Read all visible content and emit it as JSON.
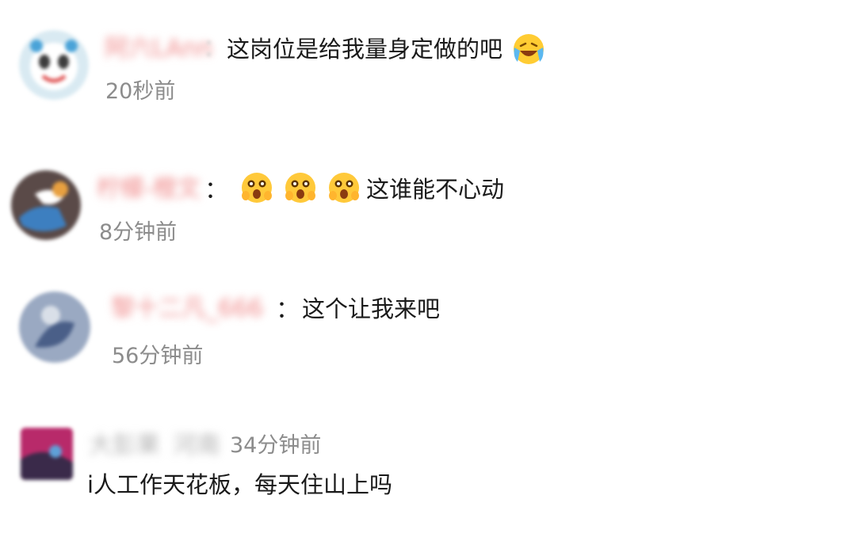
{
  "comments": [
    {
      "username": "阿六LAnn",
      "separator": "：",
      "text": "这岗位是给我量身定做的吧",
      "emoji_icons": [
        "crying-laughing-emoji-icon"
      ],
      "time": "20秒前"
    },
    {
      "username": "柠檬-橙文",
      "separator": "：",
      "emoji_icons": [
        "excited-face-emoji-icon",
        "excited-face-emoji-icon",
        "excited-face-emoji-icon"
      ],
      "text": "这谁能不心动",
      "time": "8分钟前"
    },
    {
      "username": "黎十二凡_666",
      "separator": "：",
      "text": "这个让我来吧",
      "time": "56分钟前"
    },
    {
      "username": "大彭果",
      "location": "河南",
      "text": "i人工作天花板，每天住山上吗",
      "time": "34分钟前"
    }
  ],
  "colors": {
    "username_pink": "#f08a8a",
    "username_gray": "#b4b4b4",
    "time_gray": "#8c8c8c",
    "text": "#1a1a1a"
  }
}
